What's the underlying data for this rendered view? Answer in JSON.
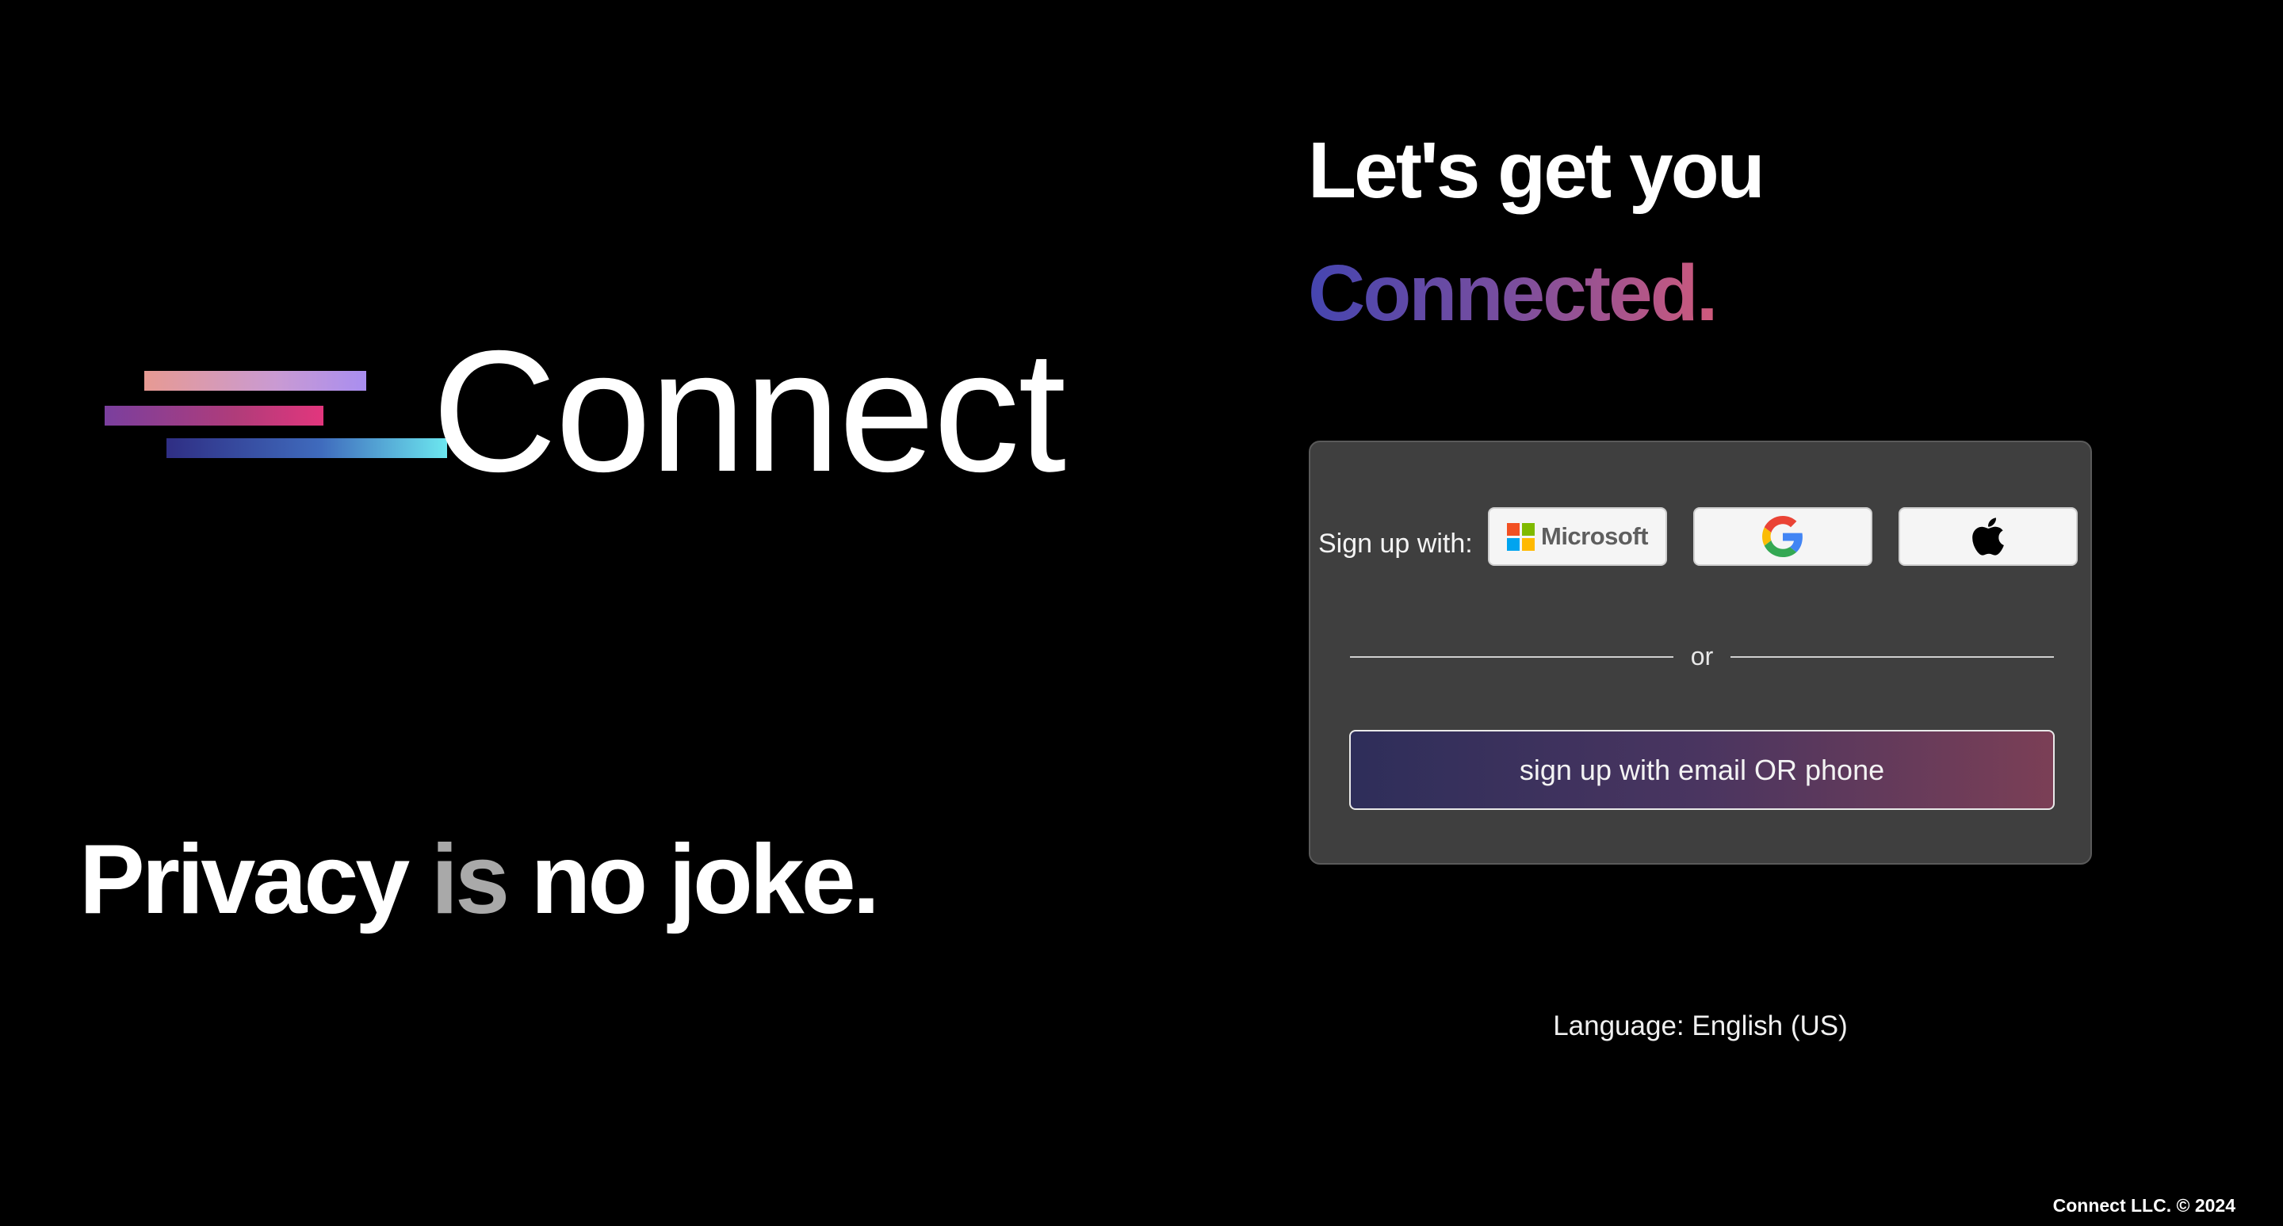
{
  "brand": {
    "name": "Connect",
    "tagline": {
      "part1": "Privacy",
      "part2": "is",
      "part3": "no joke."
    }
  },
  "heading": {
    "line1": "Let's get you",
    "line2": "Connected."
  },
  "signup": {
    "label": "Sign up with:",
    "providers": {
      "microsoft": {
        "text": "Microsoft",
        "icon": "microsoft-logo-icon"
      },
      "google": {
        "icon": "google-logo-icon"
      },
      "apple": {
        "icon": "apple-logo-icon"
      }
    },
    "divider_text": "or",
    "email_button_label": "sign up with email OR phone"
  },
  "language": "Language: English (US)",
  "footer": "Connect LLC. © 2024",
  "colors": {
    "background": "#000000",
    "card": "#3f3f3f",
    "muted_text": "#a9a9a9",
    "gradient_start": "#4545b0",
    "gradient_end": "#cf5a7c"
  }
}
